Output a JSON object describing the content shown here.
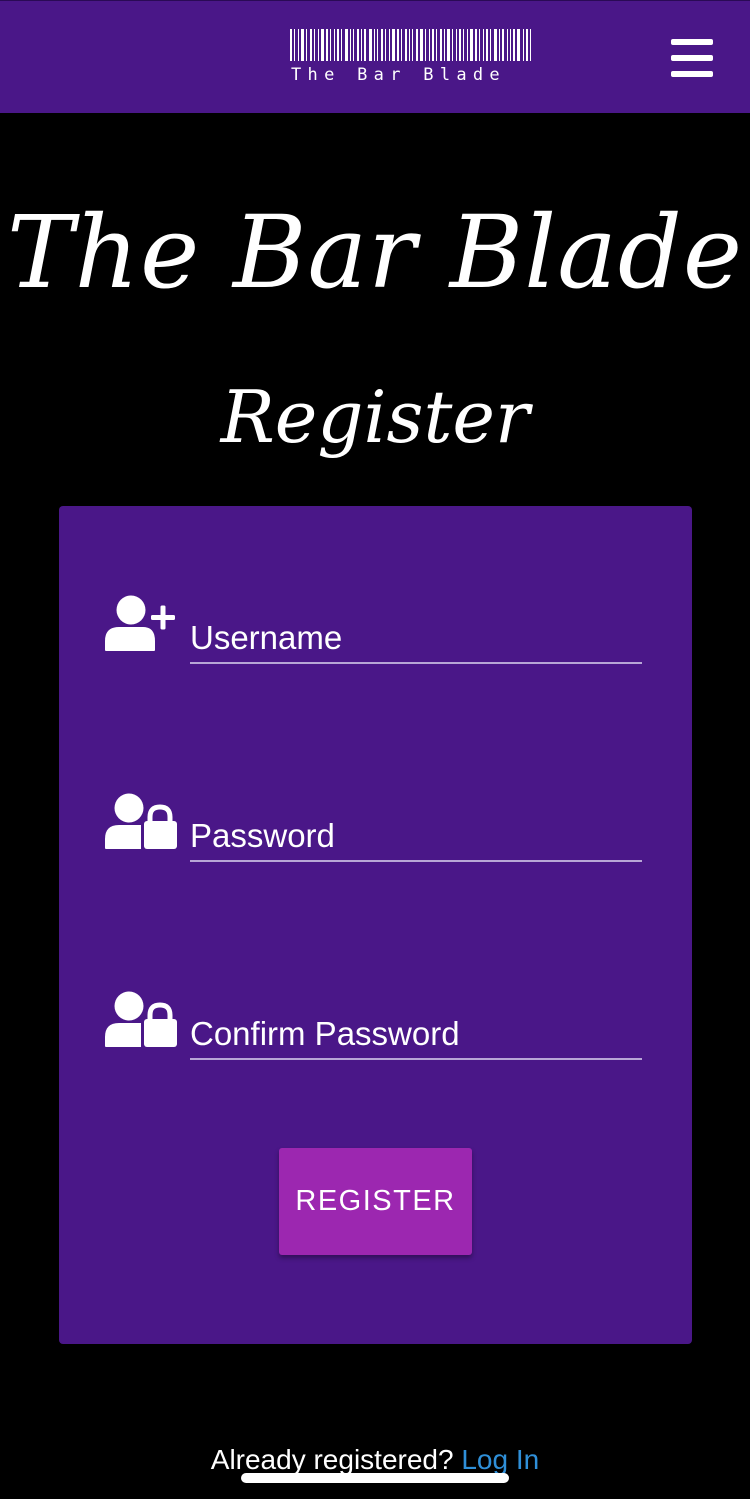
{
  "header": {
    "logo_text": "The Bar Blade",
    "logo_icon": "barcode-icon",
    "menu_icon": "hamburger-menu-icon"
  },
  "main": {
    "site_title": "The Bar Blade",
    "heading": "Register"
  },
  "form": {
    "username": {
      "placeholder": "Username",
      "value": "",
      "icon": "user-plus-icon"
    },
    "password": {
      "placeholder": "Password",
      "value": "",
      "icon": "user-lock-icon"
    },
    "confirm_password": {
      "placeholder": "Confirm Password",
      "value": "",
      "icon": "user-lock-icon"
    },
    "submit_label": "REGISTER"
  },
  "footer": {
    "prompt": "Already registered?",
    "link_label": "Log In"
  },
  "colors": {
    "background": "#000000",
    "primary_purple": "#4a1788",
    "button_purple": "#9c27b0",
    "link_blue": "#2f8fd8",
    "text": "#ffffff"
  }
}
